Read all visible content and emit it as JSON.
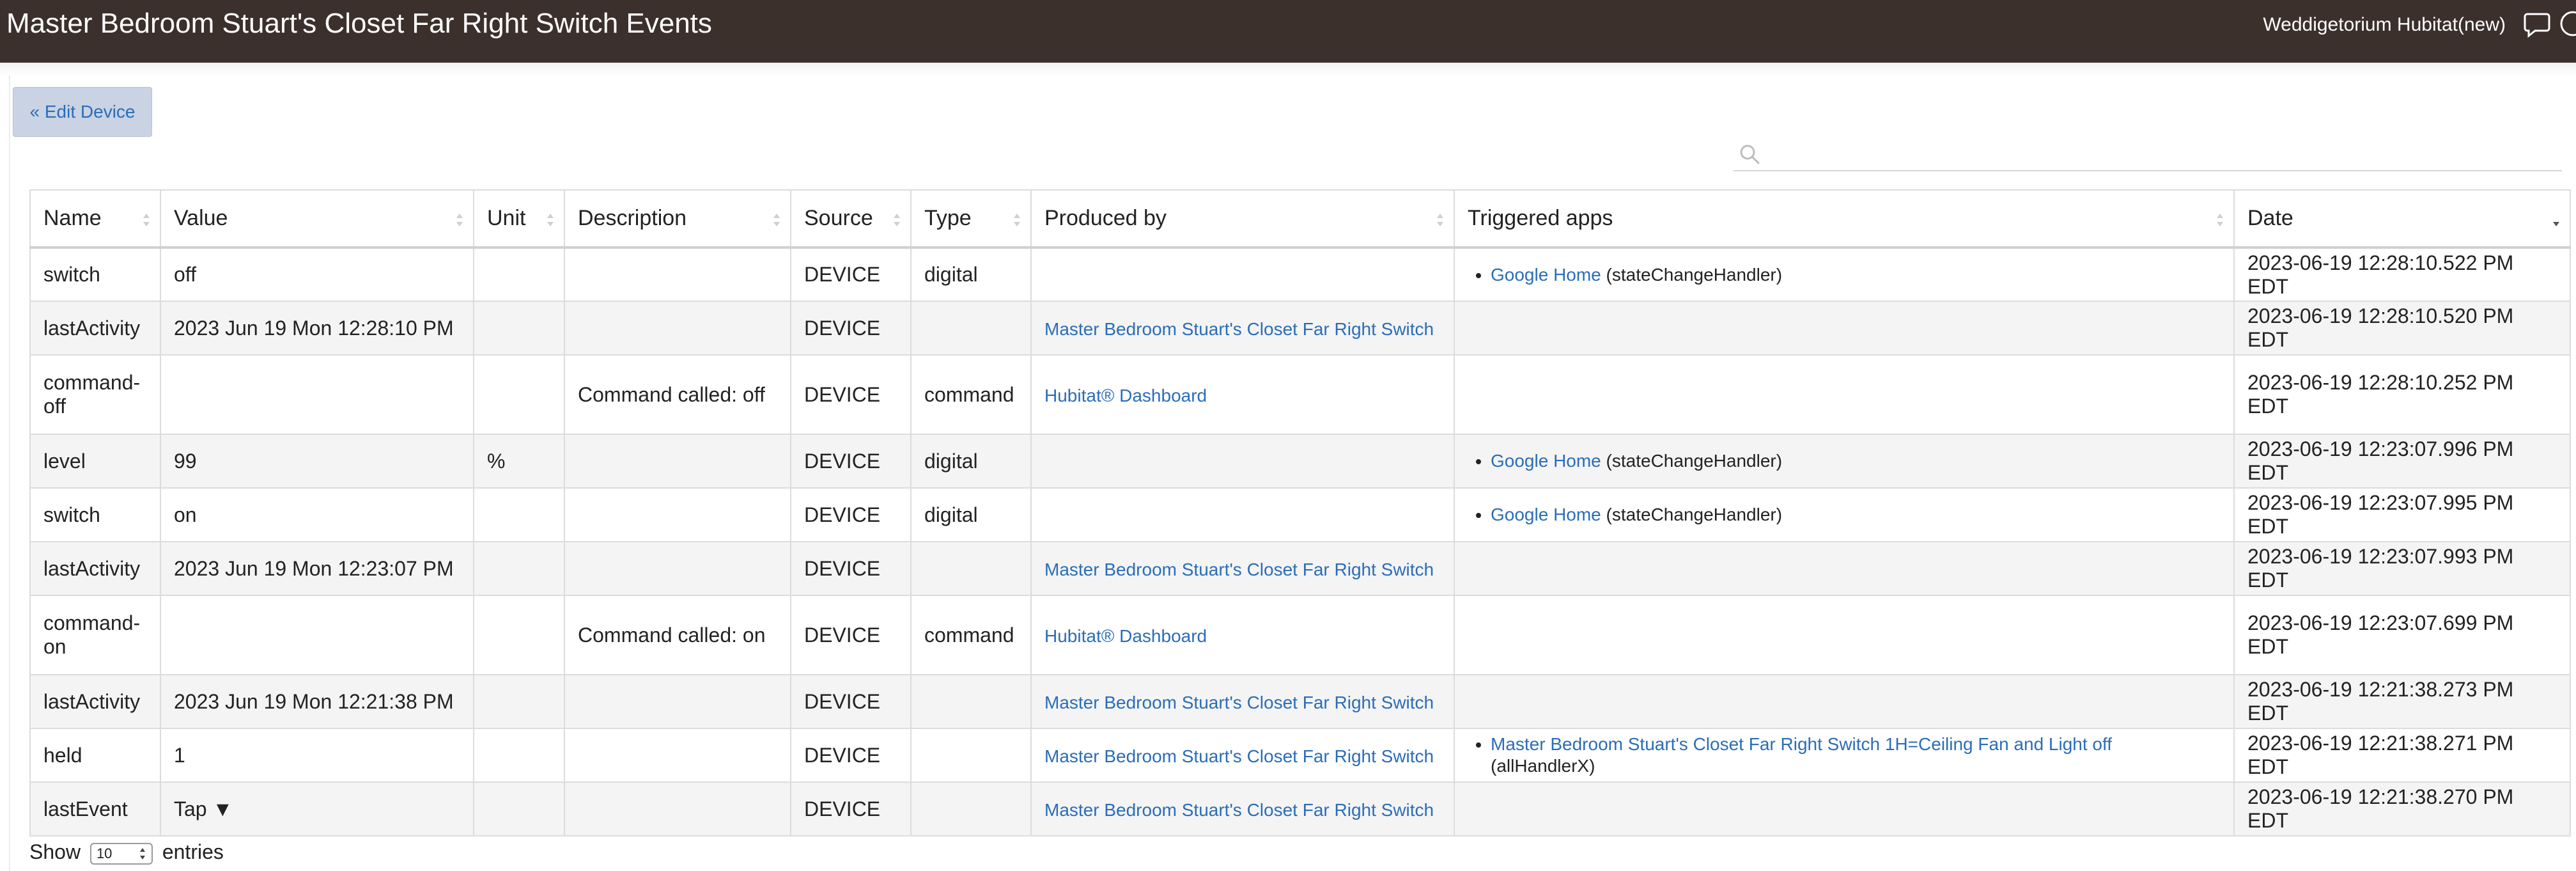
{
  "header": {
    "title": "Master Bedroom Stuart's Closet Far Right Switch Events",
    "hub_name": "Weddigetorium Hubitat(new)"
  },
  "toolbar": {
    "edit_device_label": "« Edit Device"
  },
  "search": {
    "value": "",
    "placeholder": ""
  },
  "table": {
    "columns": [
      "Name",
      "Value",
      "Unit",
      "Description",
      "Source",
      "Type",
      "Produced by",
      "Triggered apps",
      "Date"
    ],
    "sorted_column": "Date",
    "sort_direction": "descending",
    "rows": [
      {
        "name": "switch",
        "value": "off",
        "unit": "",
        "description": "",
        "source": "DEVICE",
        "type": "digital",
        "produced_by": "",
        "triggered_app": "Google Home",
        "triggered_handler": "(stateChangeHandler)",
        "date": "2023-06-19 12:28:10.522 PM EDT"
      },
      {
        "name": "lastActivity",
        "value": "2023 Jun 19 Mon 12:28:10 PM",
        "unit": "",
        "description": "",
        "source": "DEVICE",
        "type": "",
        "produced_by": "Master Bedroom Stuart's Closet Far Right Switch",
        "triggered_app": "",
        "triggered_handler": "",
        "date": "2023-06-19 12:28:10.520 PM EDT"
      },
      {
        "name": "command-off",
        "value": "",
        "unit": "",
        "description": "Command called: off",
        "source": "DEVICE",
        "type": "command",
        "produced_by": "Hubitat® Dashboard",
        "triggered_app": "",
        "triggered_handler": "",
        "date": "2023-06-19 12:28:10.252 PM EDT"
      },
      {
        "name": "level",
        "value": "99",
        "unit": "%",
        "description": "",
        "source": "DEVICE",
        "type": "digital",
        "produced_by": "",
        "triggered_app": "Google Home",
        "triggered_handler": "(stateChangeHandler)",
        "date": "2023-06-19 12:23:07.996 PM EDT"
      },
      {
        "name": "switch",
        "value": "on",
        "unit": "",
        "description": "",
        "source": "DEVICE",
        "type": "digital",
        "produced_by": "",
        "triggered_app": "Google Home",
        "triggered_handler": "(stateChangeHandler)",
        "date": "2023-06-19 12:23:07.995 PM EDT"
      },
      {
        "name": "lastActivity",
        "value": "2023 Jun 19 Mon 12:23:07 PM",
        "unit": "",
        "description": "",
        "source": "DEVICE",
        "type": "",
        "produced_by": "Master Bedroom Stuart's Closet Far Right Switch",
        "triggered_app": "",
        "triggered_handler": "",
        "date": "2023-06-19 12:23:07.993 PM EDT"
      },
      {
        "name": "command-on",
        "value": "",
        "unit": "",
        "description": "Command called: on",
        "source": "DEVICE",
        "type": "command",
        "produced_by": "Hubitat® Dashboard",
        "triggered_app": "",
        "triggered_handler": "",
        "date": "2023-06-19 12:23:07.699 PM EDT"
      },
      {
        "name": "lastActivity",
        "value": "2023 Jun 19 Mon 12:21:38 PM",
        "unit": "",
        "description": "",
        "source": "DEVICE",
        "type": "",
        "produced_by": "Master Bedroom Stuart's Closet Far Right Switch",
        "triggered_app": "",
        "triggered_handler": "",
        "date": "2023-06-19 12:21:38.273 PM EDT"
      },
      {
        "name": "held",
        "value": "1",
        "unit": "",
        "description": "",
        "source": "DEVICE",
        "type": "",
        "produced_by": "Master Bedroom Stuart's Closet Far Right Switch",
        "triggered_app": "Master Bedroom Stuart's Closet Far Right Switch 1H=Ceiling Fan and Light off",
        "triggered_handler": "(allHandlerX)",
        "date": "2023-06-19 12:21:38.271 PM EDT"
      },
      {
        "name": "lastEvent",
        "value": "Tap ▼",
        "unit": "",
        "description": "",
        "source": "DEVICE",
        "type": "",
        "produced_by": "Master Bedroom Stuart's Closet Far Right Switch",
        "triggered_app": "",
        "triggered_handler": "",
        "date": "2023-06-19 12:21:38.270 PM EDT"
      }
    ]
  },
  "footer": {
    "show_label": "Show",
    "entries_selected": "10",
    "entries_label": "entries"
  },
  "icons": {
    "chat": "chat-bubble-icon",
    "help": "help-circle-icon",
    "search": "search-icon",
    "sort": "sort-arrows-icon"
  },
  "colors": {
    "topbar": "#3b302c",
    "link": "#2a6db8",
    "button_bg": "#c9d3e3",
    "row_stripe": "#f4f4f4"
  }
}
